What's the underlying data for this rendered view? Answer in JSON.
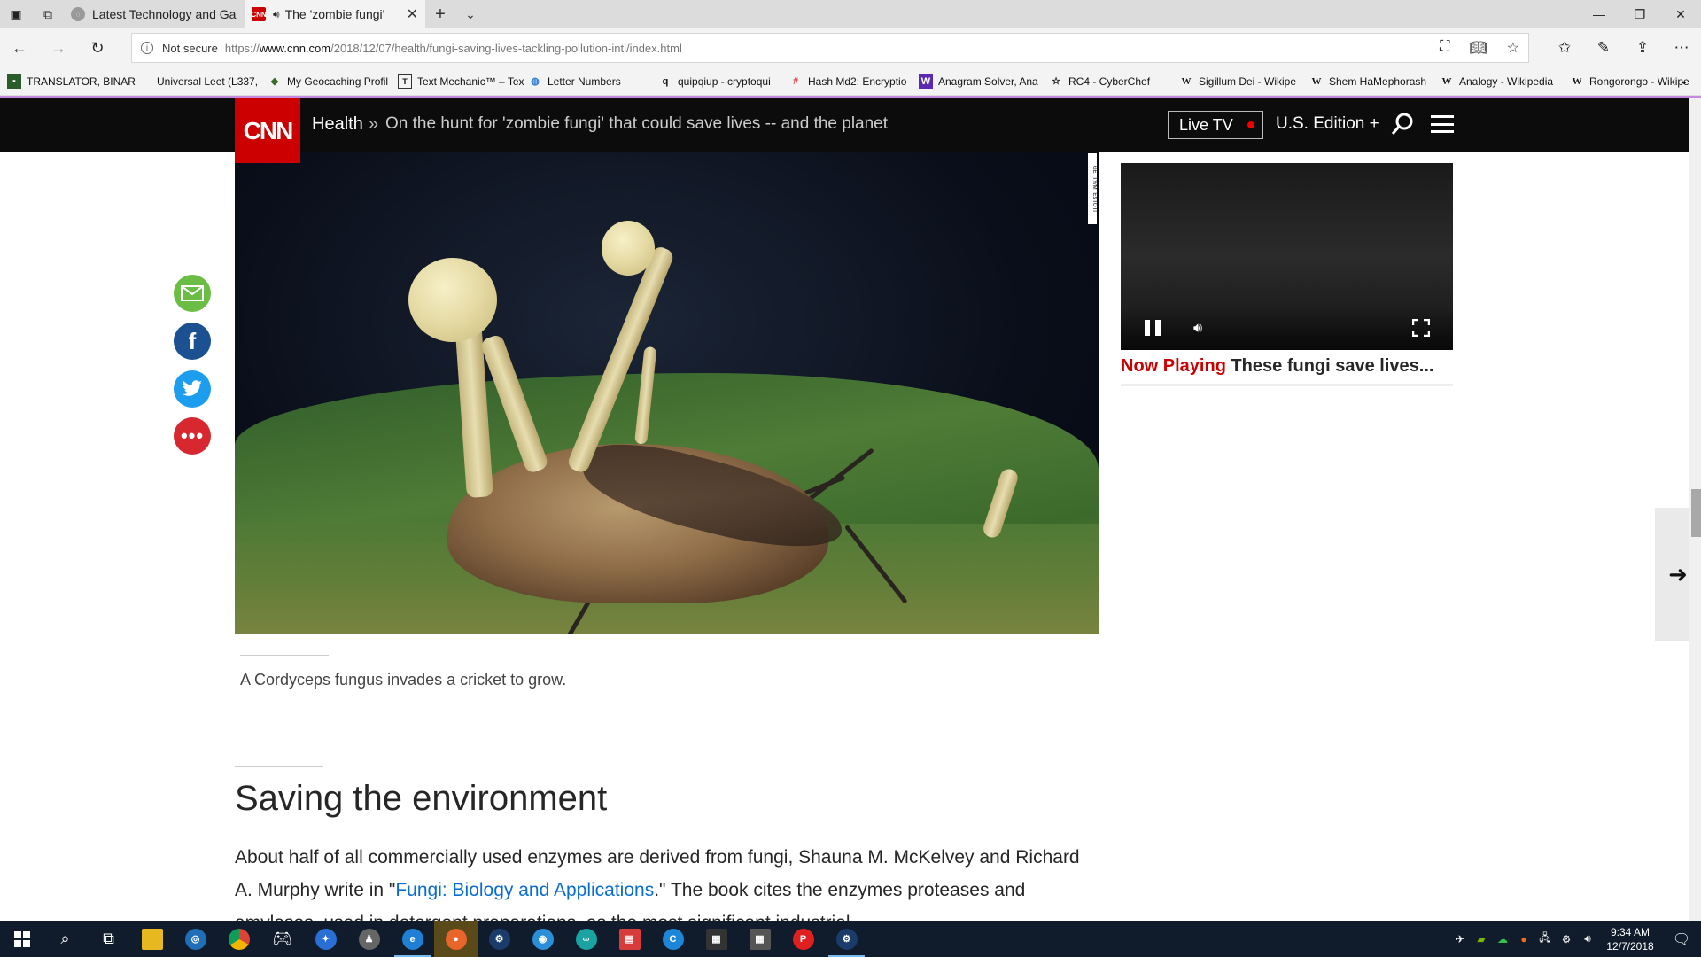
{
  "browser": {
    "tabs": [
      {
        "title": "Latest Technology and Gam",
        "favicon": "generic-site-icon"
      },
      {
        "title": "The 'zombie fungi'",
        "favicon": "cnn-icon",
        "audio": true
      }
    ],
    "address": {
      "security": "Not secure",
      "prefix": "https://",
      "host": "www.cnn.com",
      "path": "/2018/12/07/health/fungi-saving-lives-tackling-pollution-intl/index.html"
    },
    "favorites": [
      {
        "label": "TRANSLATOR, BINAR",
        "icon": "square-icon"
      },
      {
        "label": "Universal Leet (L337,",
        "icon": "blank-icon"
      },
      {
        "label": "My Geocaching Profil",
        "icon": "geocache-icon"
      },
      {
        "label": "Text Mechanic™ – Tex",
        "icon": "text-icon"
      },
      {
        "label": "Letter Numbers",
        "icon": "globe-icon"
      },
      {
        "label": "quipqiup - cryptoqui",
        "icon": "q-icon"
      },
      {
        "label": "Hash Md2: Encryptio",
        "icon": "hash-icon"
      },
      {
        "label": "Anagram Solver, Ana",
        "icon": "w-icon"
      },
      {
        "label": "RC4 - CyberChef",
        "icon": "star-icon"
      },
      {
        "label": "Sigillum Dei - Wikipe",
        "icon": "wikipedia-icon"
      },
      {
        "label": "Shem HaMephorash",
        "icon": "wikipedia-icon"
      },
      {
        "label": "Analogy - Wikipedia",
        "icon": "wikipedia-icon"
      },
      {
        "label": "Rongorongo - Wikipe",
        "icon": "wikipedia-icon"
      }
    ]
  },
  "cnn": {
    "logo": "CNN",
    "section": "Health",
    "separator": "»",
    "headline": "On the hunt for 'zombie fungi' that could save lives -- and the planet",
    "live_tv": "Live TV",
    "edition": "U.S. Edition +",
    "image_credit": "GETTY/MTESTOTI",
    "caption": "A Cordyceps fungus invades a cricket to grow.",
    "section_title": "Saving the environment",
    "paragraph": {
      "before": "About half of all commercially used enzymes are derived from fungi, Shauna M. McKelvey and Richard A. Murphy write in \"",
      "link": "Fungi: Biology and Applications",
      "after": ".\" The book cites the enzymes proteases and amylases, used in detergent preparations, as the most significant industrial"
    },
    "video": {
      "now_playing_label": "Now Playing",
      "now_playing_title": "These fungi save lives..."
    }
  },
  "taskbar": {
    "time": "9:34 AM",
    "date": "12/7/2018"
  },
  "colors": {
    "cnn_red": "#cc0000",
    "link_blue": "#096dd2",
    "taskbar": "#101c2c"
  }
}
